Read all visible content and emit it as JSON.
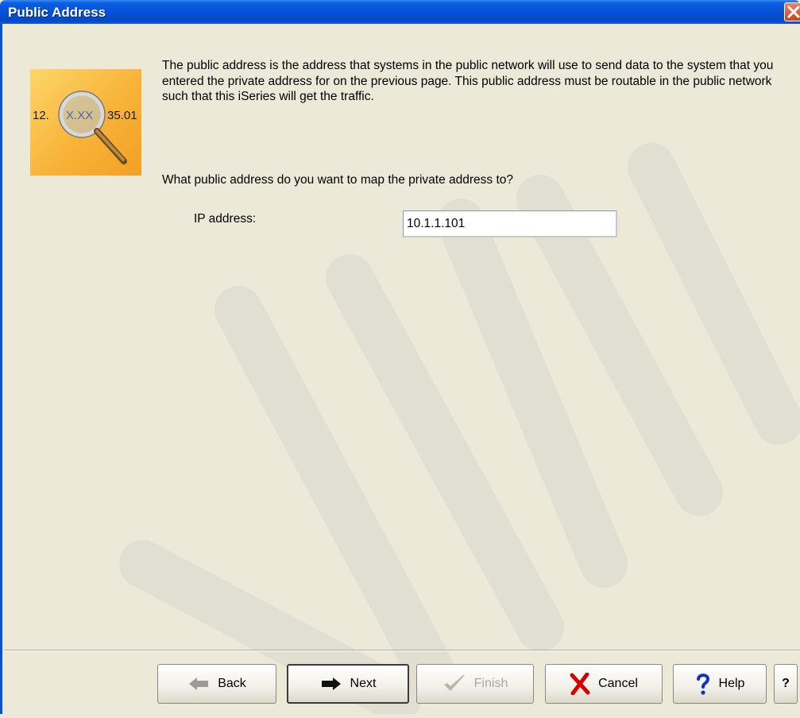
{
  "window": {
    "title": "Public Address"
  },
  "icon": {
    "text_left": "12.",
    "text_middle": "X.XX",
    "text_right": "35.01"
  },
  "description": "The public address is the address that systems in the public network will use to send data to the system that you entered the private address for on the previous page.  This public address must be routable in the public network such that this iSeries will get the traffic.",
  "question": "What public address do you want to map the private address to?",
  "ip": {
    "label": "IP address:",
    "value": "10.1.1.101"
  },
  "buttons": {
    "back": "Back",
    "next": "Next",
    "finish": "Finish",
    "cancel": "Cancel",
    "help": "Help",
    "whats_this": "?"
  },
  "colors": {
    "titlebar": "#0652d6",
    "dialog_bg": "#ece9d8",
    "close_button": "#d5532c",
    "cancel_x": "#d40000",
    "help_q": "#1433b8"
  }
}
